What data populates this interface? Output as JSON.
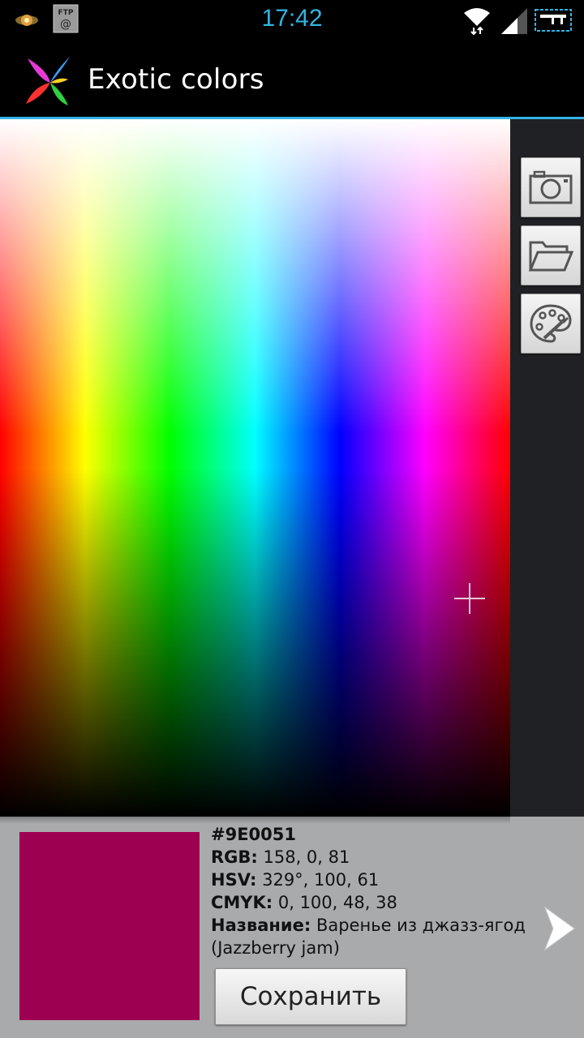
{
  "status_bar": {
    "time": "17:42",
    "time_color": "#33b5e5",
    "icons": [
      "sun-notification-icon",
      "ftp-notification-icon",
      "wifi-icon",
      "signal-icon",
      "battery-icon"
    ],
    "ftp_label": "FTP"
  },
  "action_bar": {
    "title": "Exotic colors",
    "accent": "#33b5e5"
  },
  "side_buttons": [
    {
      "name": "camera-icon"
    },
    {
      "name": "folder-icon"
    },
    {
      "name": "palette-icon"
    }
  ],
  "color_info": {
    "hex": "#9E0051",
    "swatch_color": "#9e0051",
    "rgb_label": "RGB:",
    "rgb_value": " 158, 0, 81",
    "hsv_label": "HSV:",
    "hsv_value": " 329°, 100, 61",
    "cmyk_label": "CMYK:",
    "cmyk_value": " 0, 100, 48, 38",
    "name_label": "Название:",
    "name_value": " Варенье из джазз-ягод",
    "name_alt": "(Jazzberry jam)"
  },
  "save_label": "Сохранить"
}
